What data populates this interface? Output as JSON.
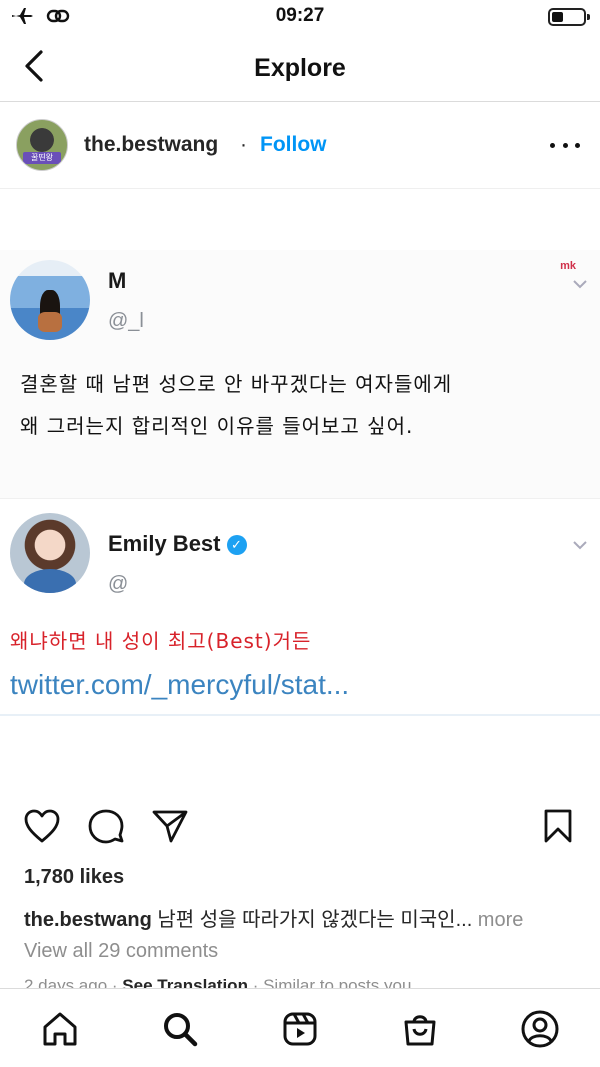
{
  "status_bar": {
    "time": "09:27",
    "battery_level": 0.35,
    "icons": [
      "airplane-icon",
      "link-icon",
      "battery-icon"
    ]
  },
  "header": {
    "title": "Explore",
    "back_icon": "chevron-left-icon"
  },
  "post": {
    "username": "the.bestwang",
    "separator": "·",
    "follow_label": "Follow",
    "avatar_tag": "꿀띤왕",
    "more_icon": "more-horizontal-icon",
    "accent_color": "#0095f6"
  },
  "tweet1": {
    "name": "M",
    "handle": "@_l",
    "mk_label": "mk",
    "line1": "결혼할 때 남편 성으로 안 바꾸겠다는 여자들에게",
    "line2": "왜 그러는지 합리적인 이유를 들어보고 싶어."
  },
  "tweet2": {
    "name": "Emily Best",
    "verified_icon": "verified-badge-icon",
    "handle": "@",
    "reply": "왜냐하면 내 성이 최고(Best)거든",
    "link": "twitter.com/_mercyful/stat..."
  },
  "actions": {
    "icons": [
      "heart-icon",
      "comment-icon",
      "share-icon",
      "bookmark-icon"
    ]
  },
  "likes": "1,780 likes",
  "caption": {
    "user": "the.bestwang",
    "text": " 남편 성을 따라가지 않겠다는 미국인...",
    "more": " more"
  },
  "view_comments": "View all 29 comments",
  "meta": {
    "time": "2 days ago",
    "dot": " · ",
    "translation": "See Translation",
    "similar": "Similar to posts you"
  },
  "tab_bar": {
    "icons": [
      "home-icon",
      "search-icon",
      "reels-icon",
      "shop-icon",
      "profile-icon"
    ]
  }
}
